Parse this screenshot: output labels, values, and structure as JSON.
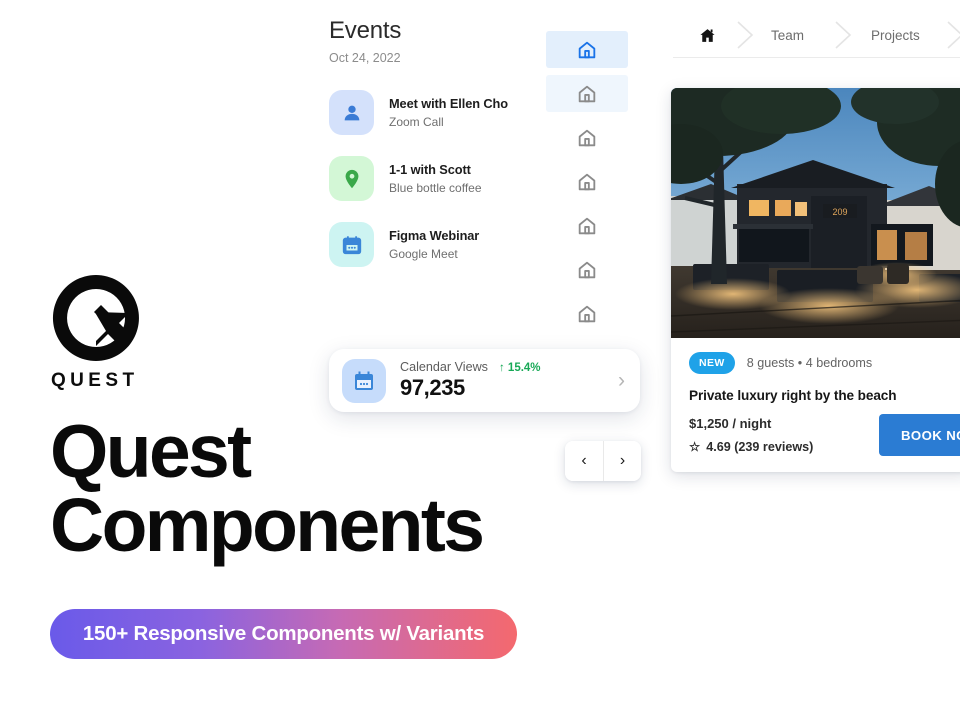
{
  "brand": {
    "logo_word": "QUEST",
    "logo_icon": "quest-circle-arrow-logo",
    "headline_line1": "Quest",
    "headline_line2": "Components",
    "pill_label": "150+ Responsive Components w/ Variants",
    "gradient_start": "#6a5ae9",
    "gradient_end": "#f4696e"
  },
  "events": {
    "title": "Events",
    "date": "Oct 24, 2022",
    "items": [
      {
        "title": "Meet with Ellen Cho",
        "subtitle": "Zoom Call",
        "icon": "person-icon",
        "icon_bg": "#d4e1fb"
      },
      {
        "title": "1-1 with Scott",
        "subtitle": "Blue bottle coffee",
        "icon": "map-pin-icon",
        "icon_bg": "#d3f7d6"
      },
      {
        "title": "Figma Webinar",
        "subtitle": "Google Meet",
        "icon": "calendar-icon",
        "icon_bg": "#cdf4f2"
      }
    ]
  },
  "rail": {
    "icon_name": "home-icon",
    "active_color": "#1a73e8",
    "inactive_color": "#8b8b8b",
    "items": [
      {
        "state": "selected"
      },
      {
        "state": "hover"
      },
      {
        "state": "default"
      },
      {
        "state": "default"
      },
      {
        "state": "default"
      },
      {
        "state": "default"
      },
      {
        "state": "default"
      }
    ]
  },
  "stat_card": {
    "icon": "calendar-icon",
    "label": "Calendar Views",
    "delta": "↑ 15.4%",
    "delta_color": "#18a957",
    "value": "97,235",
    "chevron": "›"
  },
  "carousel_nav": {
    "prev_label": "‹",
    "next_label": "›",
    "prev_icon": "chevron-left-icon",
    "next_icon": "chevron-right-icon"
  },
  "breadcrumb": {
    "home_icon": "home-icon",
    "items": [
      {
        "label": "Team"
      },
      {
        "label": "Projects"
      }
    ]
  },
  "property": {
    "photo_alt": "modern-house-at-dusk-photo",
    "badge": "NEW",
    "badge_color": "#1fa2e8",
    "meta": "8 guests • 4 bedrooms",
    "title": "Private luxury right by the beach",
    "price": "$1,250 / night",
    "star_icon": "star-outline-icon",
    "rating": "4.69 (239 reviews)",
    "book_label": "BOOK NOW",
    "book_color": "#2b7cd3"
  }
}
